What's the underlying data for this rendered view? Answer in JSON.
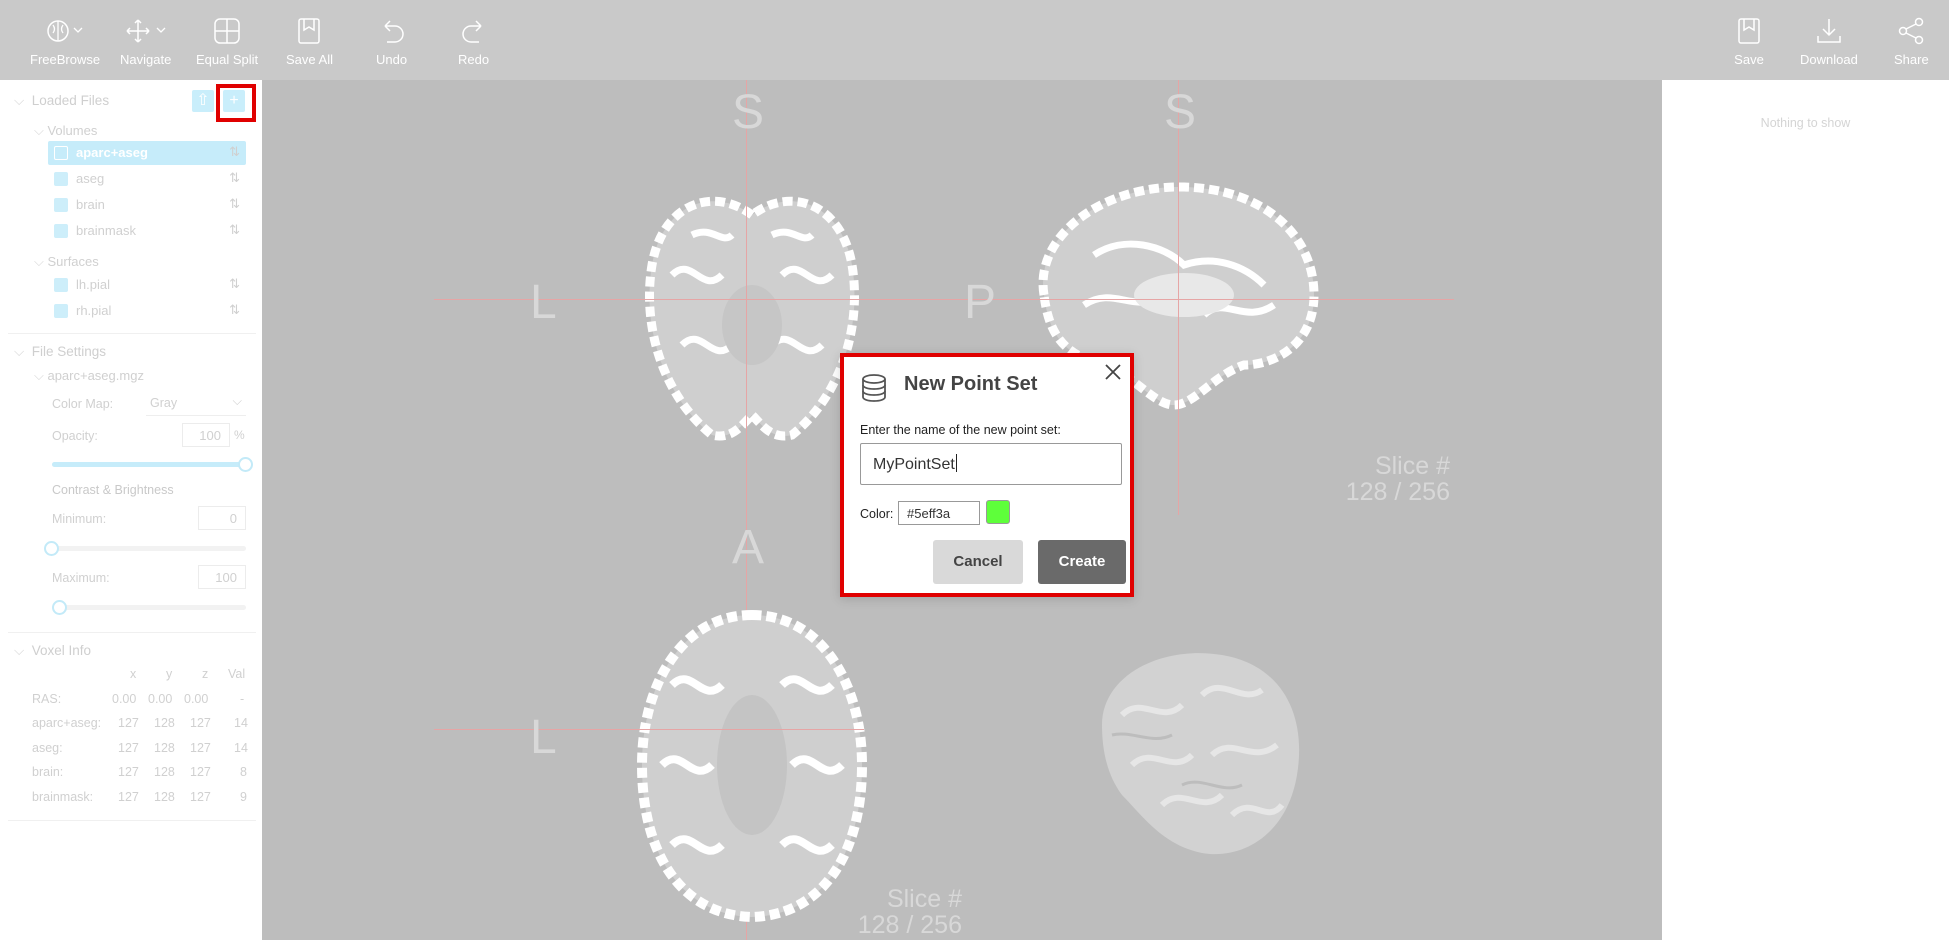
{
  "toolbar": {
    "freebrowse": "FreeBrowse",
    "navigate": "Navigate",
    "equal_split": "Equal Split",
    "save_all": "Save All",
    "undo": "Undo",
    "redo": "Redo",
    "save": "Save",
    "download": "Download",
    "share": "Share"
  },
  "loaded_files": {
    "title": "Loaded Files",
    "volumes_title": "Volumes",
    "volumes": [
      "aparc+aseg",
      "aseg",
      "brain",
      "brainmask"
    ],
    "surfaces_title": "Surfaces",
    "surfaces": [
      "lh.pial",
      "rh.pial"
    ]
  },
  "file_settings": {
    "title": "File Settings",
    "file_name": "aparc+aseg.mgz",
    "color_map_label": "Color Map:",
    "color_map_value": "Gray",
    "opacity_label": "Opacity:",
    "opacity_value": "100",
    "opacity_unit": "%",
    "opacity_fraction": 1.0,
    "contrast_title": "Contrast & Brightness",
    "minimum_label": "Minimum:",
    "minimum_value": "0",
    "maximum_label": "Maximum:",
    "maximum_value": "100"
  },
  "voxel_info": {
    "title": "Voxel Info",
    "headers": [
      "x",
      "y",
      "z",
      "Val"
    ],
    "rows": [
      {
        "name": "RAS:",
        "x": "0.00",
        "y": "0.00",
        "z": "0.00",
        "val": "-"
      },
      {
        "name": "aparc+aseg:",
        "x": "127",
        "y": "128",
        "z": "127",
        "val": "14"
      },
      {
        "name": "aseg:",
        "x": "127",
        "y": "128",
        "z": "127",
        "val": "14"
      },
      {
        "name": "brain:",
        "x": "127",
        "y": "128",
        "z": "127",
        "val": "8"
      },
      {
        "name": "brainmask:",
        "x": "127",
        "y": "128",
        "z": "127",
        "val": "9"
      }
    ]
  },
  "viewer": {
    "coronal_top": "S",
    "coronal_left": "L",
    "sagittal_top": "S",
    "sagittal_left": "P",
    "slice_label_1": "Slice #",
    "slice_value_1": "128 / 256",
    "axial_top": "A",
    "axial_left": "L",
    "slice_label_2": "Slice #",
    "slice_value_2": "128 / 256"
  },
  "right_panel": {
    "empty_text": "Nothing to show"
  },
  "dialog": {
    "title": "New Point Set",
    "prompt": "Enter the name of the new point set:",
    "name_value": "MyPointSet",
    "color_label": "Color:",
    "color_value": "#5eff3a",
    "cancel_label": "Cancel",
    "create_label": "Create"
  },
  "colors": {
    "toolbar_bg": "#c9c9c9",
    "viewer_bg": "#bdbdbd",
    "accent": "#c6ecfa",
    "highlight": "#e00000",
    "create_btn": "#6a6a6a",
    "swatch": "#5eff3a"
  },
  "icons": [
    "brain-icon",
    "move-icon",
    "grid-icon",
    "save-icon",
    "undo-icon",
    "redo-icon",
    "download-icon",
    "share-icon",
    "database-icon",
    "close-icon",
    "upload-icon",
    "plus-icon",
    "sort-icon",
    "chevron-down-icon"
  ]
}
